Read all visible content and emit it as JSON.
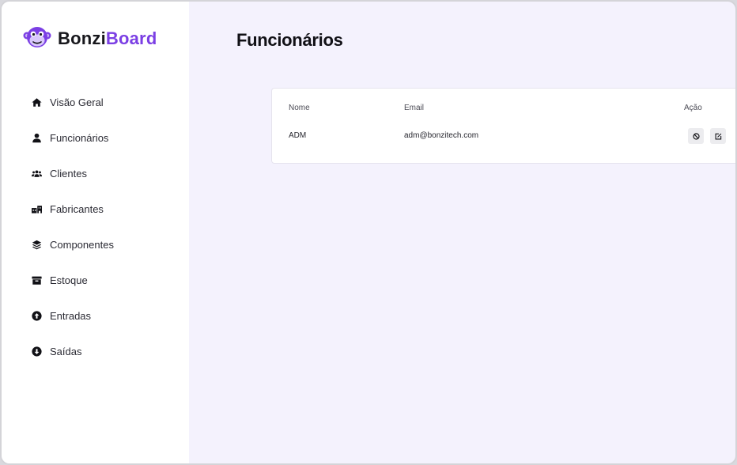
{
  "brand": {
    "part1": "Bonzi",
    "part2": "Board",
    "logo_icon": "monkey-face-icon"
  },
  "sidebar": {
    "items": [
      {
        "label": "Visão Geral",
        "icon": "home-icon"
      },
      {
        "label": "Funcionários",
        "icon": "user-icon"
      },
      {
        "label": "Clientes",
        "icon": "users-icon"
      },
      {
        "label": "Fabricantes",
        "icon": "factory-icon"
      },
      {
        "label": "Componentes",
        "icon": "layers-icon"
      },
      {
        "label": "Estoque",
        "icon": "archive-box-icon"
      },
      {
        "label": "Entradas",
        "icon": "arrow-up-circle-icon"
      },
      {
        "label": "Saídas",
        "icon": "arrow-down-circle-icon"
      }
    ]
  },
  "page": {
    "title": "Funcionários"
  },
  "table": {
    "headers": {
      "nome": "Nome",
      "email": "Email",
      "acao": "Ação"
    },
    "rows": [
      {
        "nome": "ADM",
        "email": "adm@bonzitech.com"
      }
    ]
  },
  "colors": {
    "accent": "#7b3fe4",
    "background": "#f4f2fd",
    "sidebar": "#ffffff"
  }
}
